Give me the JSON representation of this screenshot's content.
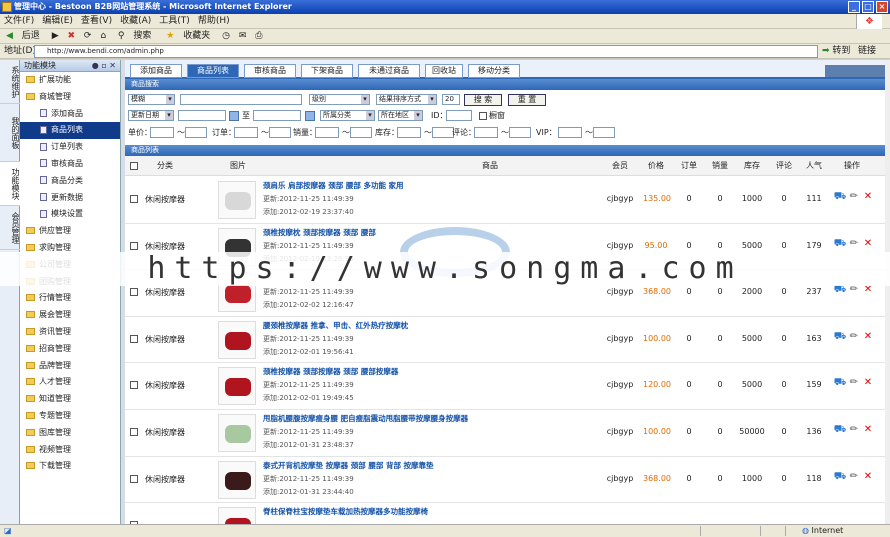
{
  "window": {
    "title": "管理中心 - Bestoon B2B网站管理系统 - Microsoft Internet Explorer"
  },
  "menu": [
    "文件(F)",
    "编辑(E)",
    "查看(V)",
    "收藏(A)",
    "工具(T)",
    "帮助(H)"
  ],
  "toolbar": {
    "back": "后退",
    "search": "搜索",
    "favorites": "收藏夹"
  },
  "address": {
    "label": "地址(D)",
    "url": "http://www.bendi.com/admin.php",
    "go": "转到",
    "links": "链接"
  },
  "vtabs": [
    "系统维护",
    "我的面板",
    "功能模块",
    "会员管理"
  ],
  "sidebar": {
    "title": "功能模块",
    "items": [
      {
        "label": "扩展功能",
        "type": "folder"
      },
      {
        "label": "商城管理",
        "type": "folder"
      },
      {
        "label": "添加商品",
        "type": "sub"
      },
      {
        "label": "商品列表",
        "type": "sub",
        "selected": true
      },
      {
        "label": "订单列表",
        "type": "sub"
      },
      {
        "label": "审核商品",
        "type": "sub"
      },
      {
        "label": "商品分类",
        "type": "sub"
      },
      {
        "label": "更新数据",
        "type": "sub"
      },
      {
        "label": "模块设置",
        "type": "sub"
      },
      {
        "label": "供应管理",
        "type": "folder"
      },
      {
        "label": "求购管理",
        "type": "folder"
      },
      {
        "label": "公司管理",
        "type": "folder"
      },
      {
        "label": "团购管理",
        "type": "folder"
      },
      {
        "label": "行情管理",
        "type": "folder"
      },
      {
        "label": "展会管理",
        "type": "folder"
      },
      {
        "label": "资讯管理",
        "type": "folder"
      },
      {
        "label": "招商管理",
        "type": "folder"
      },
      {
        "label": "品牌管理",
        "type": "folder"
      },
      {
        "label": "人才管理",
        "type": "folder"
      },
      {
        "label": "知道管理",
        "type": "folder"
      },
      {
        "label": "专题管理",
        "type": "folder"
      },
      {
        "label": "图库管理",
        "type": "folder"
      },
      {
        "label": "视频管理",
        "type": "folder"
      },
      {
        "label": "下载管理",
        "type": "folder"
      }
    ]
  },
  "tabs": [
    "添加商品",
    "商品列表",
    "审核商品",
    "下架商品",
    "未通过商品",
    "回收站",
    "移动分类"
  ],
  "filter": {
    "section_title": "商品搜索",
    "keyword_select": "模糊",
    "level_select": "级别",
    "sort_select": "结果排序方式",
    "page_size": "20",
    "search_btn": "搜 索",
    "reset_btn": "重 置",
    "date_select": "更新日期",
    "to": "至",
    "category_select": "所属分类",
    "area_select": "所在地区",
    "id_label": "ID：",
    "window_label": "橱窗",
    "labels": [
      "单价：",
      "订单：",
      "销量：",
      "库存：",
      "评论：",
      "VIP："
    ],
    "tilde": "～"
  },
  "list": {
    "section_title": "商品列表",
    "columns": [
      "分类",
      "图片",
      "商品",
      "会员",
      "价格",
      "订单",
      "销量",
      "库存",
      "评论",
      "人气",
      "操作"
    ],
    "rows": [
      {
        "category": "休闲按摩器",
        "title": "颈肩乐 肩部按摩器 颈部 腰部 多功能 家用",
        "updated": "更新:2012-11-25 11:49:39",
        "added": "添加:2012-02-19 23:37:40",
        "member": "cjbgyp",
        "price": "135.00",
        "orders": "0",
        "sales": "0",
        "stock": "1000",
        "comments": "0",
        "views": "111",
        "color": "#d8d8d8"
      },
      {
        "category": "休闲按摩器",
        "title": "颈椎按摩枕 颈部按摩器 颈部 腰部",
        "updated": "更新:2012-11-25 11:49:39",
        "added": "添加:2012-02-19 23:26:38",
        "member": "cjbgyp",
        "price": "95.00",
        "orders": "0",
        "sales": "0",
        "stock": "5000",
        "comments": "0",
        "views": "179",
        "color": "#333333"
      },
      {
        "category": "休闲按摩器",
        "title": "",
        "updated": "更新:2012-11-25 11:49:39",
        "added": "添加:2012-02-02 12:16:47",
        "member": "cjbgyp",
        "price": "368.00",
        "orders": "0",
        "sales": "0",
        "stock": "2000",
        "comments": "0",
        "views": "237",
        "color": "#c0202a"
      },
      {
        "category": "休闲按摩器",
        "title": "腰颈椎按摩器 推拿、甲击、红外热疗按摩枕",
        "updated": "更新:2012-11-25 11:49:39",
        "added": "添加:2012-02-01 19:56:41",
        "member": "cjbgyp",
        "price": "100.00",
        "orders": "0",
        "sales": "0",
        "stock": "5000",
        "comments": "0",
        "views": "163",
        "color": "#b0151f"
      },
      {
        "category": "休闲按摩器",
        "title": "颈椎按摩器 颈部按摩器 颈部 腰部按摩器",
        "updated": "更新:2012-11-25 11:49:39",
        "added": "添加:2012-02-01 19:49:45",
        "member": "cjbgyp",
        "price": "120.00",
        "orders": "0",
        "sales": "0",
        "stock": "5000",
        "comments": "0",
        "views": "159",
        "color": "#b0151f"
      },
      {
        "category": "休闲按摩器",
        "title": "甩脂机腰腹按摩瘦身腰 肥自瘦脂震动甩脂腰带按摩腰身按摩器",
        "updated": "更新:2012-11-25 11:49:39",
        "added": "添加:2012-01-31 23:48:37",
        "member": "cjbgyp",
        "price": "100.00",
        "orders": "0",
        "sales": "0",
        "stock": "50000",
        "comments": "0",
        "views": "136",
        "color": "#a8c8a0"
      },
      {
        "category": "休闲按摩器",
        "title": "泰式开背机按摩垫 按摩器 颈部 腰部 背部 按摩靠垫",
        "updated": "更新:2012-11-25 11:49:39",
        "added": "添加:2012-01-31 23:44:40",
        "member": "cjbgyp",
        "price": "368.00",
        "orders": "0",
        "sales": "0",
        "stock": "1000",
        "comments": "0",
        "views": "118",
        "color": "#3a1a1a"
      },
      {
        "category": "",
        "title": "脊柱保脊柱宝按摩垫车载加热按摩器多功能按摩椅",
        "updated": "",
        "added": "",
        "member": "",
        "price": "",
        "orders": "",
        "sales": "",
        "stock": "",
        "comments": "",
        "views": "",
        "color": "#b0151f"
      }
    ]
  },
  "watermark": "https://www.songma.com",
  "status": {
    "zone": "Internet"
  }
}
